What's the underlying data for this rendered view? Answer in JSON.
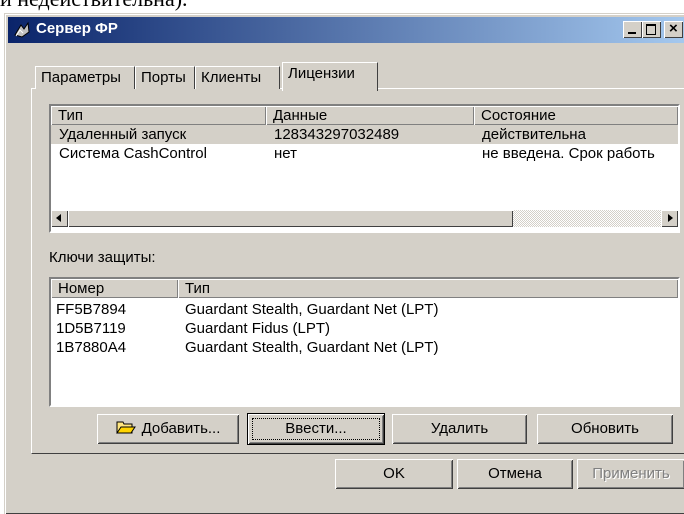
{
  "doc_fragment_text": "и недействительна).",
  "window": {
    "title": "Сервер ФР"
  },
  "tabs": [
    {
      "label": "Параметры",
      "active": false
    },
    {
      "label": "Порты",
      "active": false
    },
    {
      "label": "Клиенты",
      "active": false
    },
    {
      "label": "Лицензии",
      "active": true
    }
  ],
  "licenses": {
    "columns": [
      "Тип",
      "Данные",
      "Состояние"
    ],
    "rows": [
      {
        "type": "Удаленный запуск",
        "data": "128343297032489",
        "state": "действительна",
        "selected": true
      },
      {
        "type": "Система CashControl",
        "data": "нет",
        "state": "не введена. Срок работь",
        "selected": false
      }
    ]
  },
  "keys": {
    "label": "Ключи защиты:",
    "columns": [
      "Номер",
      "Тип"
    ],
    "rows": [
      {
        "number": "FF5B7894",
        "type": "Guardant Stealth, Guardant Net (LPT)"
      },
      {
        "number": "1D5B7119",
        "type": "Guardant Fidus (LPT)"
      },
      {
        "number": "1B7880A4",
        "type": "Guardant Stealth, Guardant Net (LPT)"
      }
    ]
  },
  "buttons": {
    "add": "Добавить...",
    "enter": "Ввести...",
    "delete": "Удалить",
    "refresh": "Обновить",
    "ok": "OK",
    "cancel": "Отмена",
    "apply": "Применить"
  },
  "colors": {
    "selection": "#d4d0c8",
    "face": "#d4d0c8",
    "title_start": "#0a246a",
    "title_end": "#a6caf0"
  }
}
